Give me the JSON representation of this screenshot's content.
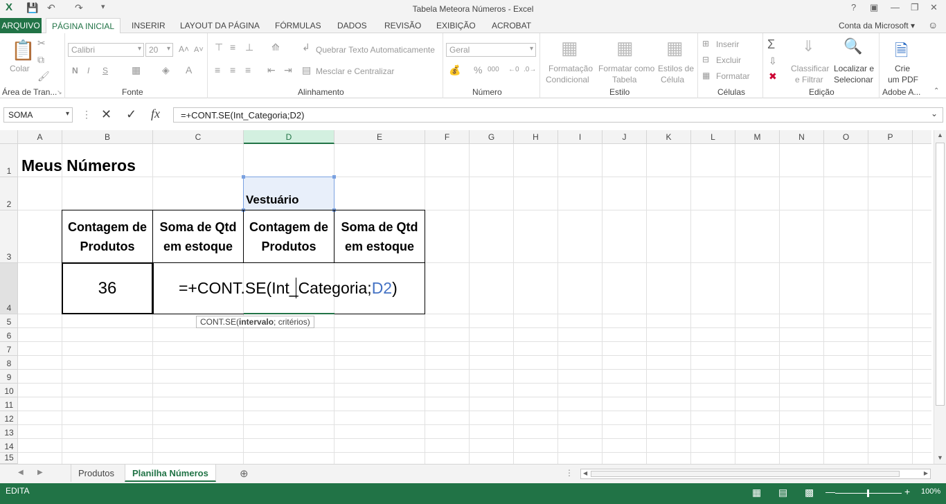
{
  "window": {
    "title": "Tabela Meteora Números - Excel"
  },
  "tabs": [
    "ARQUIVO",
    "PÁGINA INICIAL",
    "INSERIR",
    "LAYOUT DA PÁGINA",
    "FÓRMULAS",
    "DADOS",
    "REVISÃO",
    "EXIBIÇÃO",
    "ACROBAT"
  ],
  "account": "Conta da Microsoft",
  "ribbon": {
    "clipboard": {
      "paste": "Colar",
      "label": "Área de Tran..."
    },
    "font": {
      "name": "Calibri",
      "size": "20",
      "bold": "N",
      "italic": "I",
      "underline": "S",
      "label": "Fonte"
    },
    "alignment": {
      "wrap": "Quebrar Texto Automaticamente",
      "merge": "Mesclar e Centralizar",
      "label": "Alinhamento"
    },
    "number": {
      "format": "Geral",
      "label": "Número"
    },
    "styles": {
      "cond1": "Formatação",
      "cond2": "Condicional",
      "table1": "Formatar como",
      "table2": "Tabela",
      "cell1": "Estilos de",
      "cell2": "Célula",
      "label": "Estilo"
    },
    "cells": {
      "insert": "Inserir",
      "delete": "Excluir",
      "format": "Formatar",
      "label": "Células"
    },
    "editing": {
      "sort1": "Classificar",
      "sort2": "e Filtrar",
      "find1": "Localizar e",
      "find2": "Selecionar",
      "label": "Edição"
    },
    "acrobat": {
      "pdf1": "Crie",
      "pdf2": "um PDF",
      "label": "Adobe A..."
    }
  },
  "formula_bar": {
    "name_box": "SOMA",
    "formula": "=+CONT.SE(Int_Categoria;D2)"
  },
  "columns": [
    "A",
    "B",
    "C",
    "D",
    "E",
    "F",
    "G",
    "H",
    "I",
    "J",
    "K",
    "L",
    "M",
    "N",
    "O",
    "P"
  ],
  "rows": [
    "1",
    "2",
    "3",
    "4",
    "5",
    "6",
    "7",
    "8",
    "9",
    "10",
    "11",
    "12",
    "13",
    "14",
    "15"
  ],
  "cells": {
    "A1": "Meus Números",
    "D2": "Vestuário",
    "B3": "Contagem de Produtos",
    "C3": "Soma de Qtd em estoque",
    "D3": "Contagem de Produtos",
    "E3": "Soma de Qtd em estoque",
    "B4": "36",
    "edit_prefix": "=+CONT.SE(Int_Categoria;",
    "edit_ref": "D2",
    "edit_suffix": ")"
  },
  "tooltip": {
    "fn": "CONT.SE(",
    "arg1": "intervalo",
    "rest": "; critérios)"
  },
  "sheets": [
    "Produtos",
    "Planilha Números"
  ],
  "status": {
    "mode": "EDITA",
    "zoom": "100%"
  },
  "colors": {
    "excel_green": "#217346",
    "ref_blue": "#4472c4"
  }
}
